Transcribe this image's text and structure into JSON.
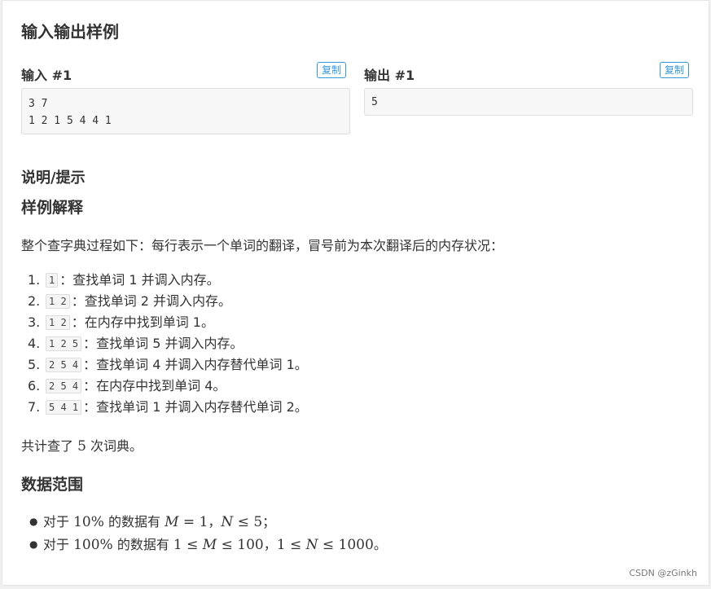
{
  "section": {
    "title": "输入输出样例"
  },
  "input": {
    "label": "输入 #1",
    "copy_label": "复制",
    "lines": [
      "3 7",
      "1 2 1 5 4 4 1"
    ]
  },
  "output": {
    "label": "输出 #1",
    "copy_label": "复制",
    "lines": [
      "5"
    ]
  },
  "explain": {
    "title": "说明/提示",
    "subtitle": "样例解释",
    "intro": "整个查字典过程如下：每行表示一个单词的翻译，冒号前为本次翻译后的内存状况：",
    "steps": [
      {
        "num": "1.",
        "chip": "1",
        "text": "：查找单词 1 并调入内存。"
      },
      {
        "num": "2.",
        "chip": "1 2",
        "text": "：查找单词 2 并调入内存。"
      },
      {
        "num": "3.",
        "chip": "1 2",
        "text": "：在内存中找到单词 1。"
      },
      {
        "num": "4.",
        "chip": "1 2 5",
        "text": "：查找单词 5 并调入内存。"
      },
      {
        "num": "5.",
        "chip": "2 5 4",
        "text": "：查找单词 4 并调入内存替代单词 1。"
      },
      {
        "num": "6.",
        "chip": "2 5 4",
        "text": "：在内存中找到单词 4。"
      },
      {
        "num": "7.",
        "chip": "5 4 1",
        "text": "：查找单词 1 并调入内存替代单词 2。"
      }
    ],
    "summary": {
      "pre": "共计查了",
      "num": "5",
      "post": "次词典。"
    }
  },
  "range": {
    "title": "数据范围",
    "items": [
      {
        "pre": "对于",
        "pct": "10%",
        "mid": "的数据有",
        "m_var": "M",
        "m_rel": " = 1",
        "sep": "，",
        "n_var": "N",
        "n_rel": " ≤ 5",
        "end": "；"
      },
      {
        "pre": "对于",
        "pct": "100%",
        "mid": "的数据有",
        "m_lo": "1 ≤ ",
        "m_var": "M",
        "m_rel": " ≤ 100",
        "sep": "，",
        "n_lo": "1 ≤ ",
        "n_var": "N",
        "n_rel": " ≤ 1000",
        "end": "。"
      }
    ]
  },
  "watermark": "CSDN @zGinkh"
}
